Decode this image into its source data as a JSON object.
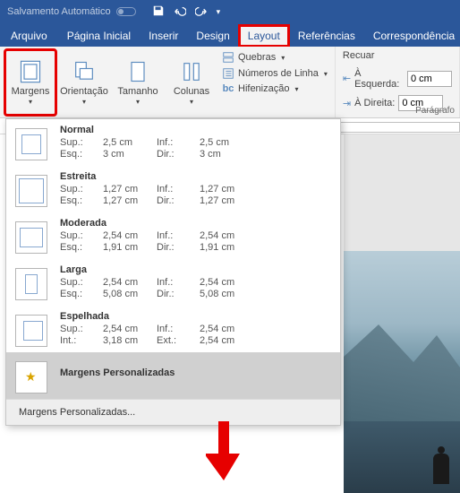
{
  "titlebar": {
    "autosave": "Salvamento Automático"
  },
  "tabs": {
    "file": "Arquivo",
    "home": "Página Inicial",
    "insert": "Inserir",
    "design": "Design",
    "layout": "Layout",
    "references": "Referências",
    "mailings": "Correspondência"
  },
  "ribbon": {
    "margins": "Margens",
    "orientation": "Orientação",
    "size": "Tamanho",
    "columns": "Colunas",
    "breaks": "Quebras",
    "line_numbers": "Números de Linha",
    "hyphenation": "Hifenização",
    "recuo_title": "Recuar",
    "left_label": "À Esquerda:",
    "right_label": "À Direita:",
    "left_value": "0 cm",
    "right_value": "0 cm",
    "paragraph": "Parágrafo"
  },
  "labels": {
    "sup": "Sup.:",
    "inf": "Inf.:",
    "esq": "Esq.:",
    "dir": "Dir.:",
    "int": "Int.:",
    "ext": "Ext.:"
  },
  "presets": {
    "normal": {
      "title": "Normal",
      "sup": "2,5 cm",
      "inf": "2,5 cm",
      "esq": "3 cm",
      "dir": "3 cm"
    },
    "estreita": {
      "title": "Estreita",
      "sup": "1,27 cm",
      "inf": "1,27 cm",
      "esq": "1,27 cm",
      "dir": "1,27 cm"
    },
    "moderada": {
      "title": "Moderada",
      "sup": "2,54 cm",
      "inf": "2,54 cm",
      "esq": "1,91 cm",
      "dir": "1,91 cm"
    },
    "larga": {
      "title": "Larga",
      "sup": "2,54 cm",
      "inf": "2,54 cm",
      "esq": "5,08 cm",
      "dir": "5,08 cm"
    },
    "espelhada": {
      "title": "Espelhada",
      "sup": "2,54 cm",
      "inf": "2,54 cm",
      "int": "3,18 cm",
      "ext": "2,54 cm"
    }
  },
  "custom_label": "Margens Personalizadas",
  "custom_footer": "Margens Personalizadas..."
}
